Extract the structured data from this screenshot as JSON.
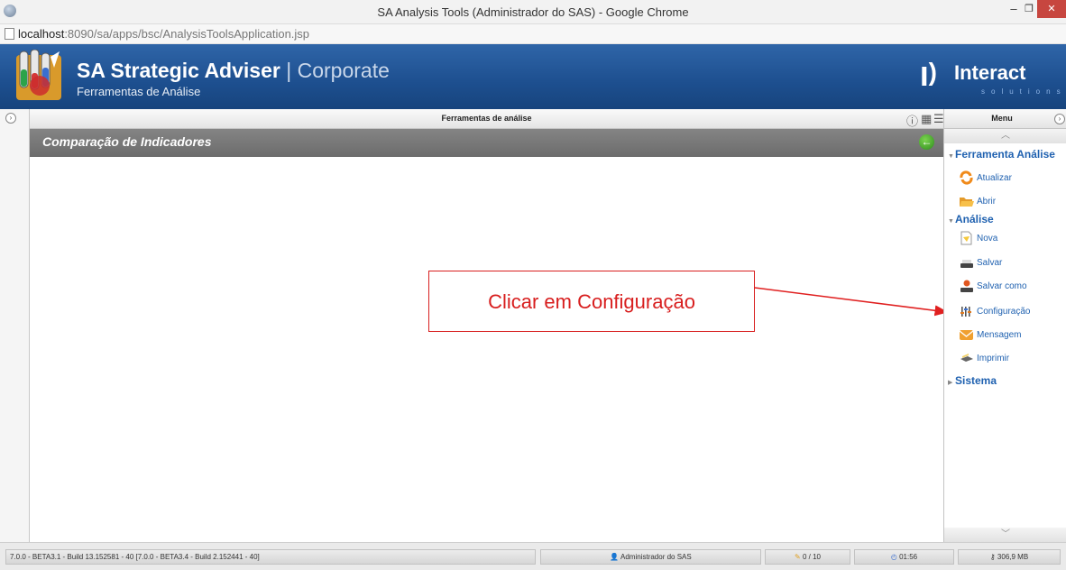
{
  "browser": {
    "window_title": "SA Analysis Tools (Administrador do SAS) - Google Chrome",
    "url_host": "localhost",
    "url_rest": ":8090/sa/apps/bsc/AnalysisToolsApplication.jsp",
    "minimize_glyph": "–",
    "maximize_glyph": "❐",
    "close_glyph": "✕"
  },
  "header": {
    "app_name_bold": "SA Strategic Adviser",
    "app_name_sep": " | ",
    "app_name_light": "Corporate",
    "subtitle": "Ferramentas de Análise",
    "brand_icon": "ꞁ)",
    "brand_name": "Interact",
    "brand_sub": "solutions"
  },
  "tabstrip": {
    "title": "Ferramentas de análise",
    "left_toggle": "›",
    "info_glyph": "ⓘ",
    "grid_glyph": "▦",
    "list_glyph": "☰"
  },
  "panel": {
    "title": "Comparação de Indicadores",
    "back_glyph": "←"
  },
  "annotation": {
    "text": "Clicar em Configuração"
  },
  "menu": {
    "title": "Menu",
    "toggle": "›",
    "scroll_up": "︿",
    "scroll_down": "﹀",
    "sections": [
      {
        "label": "Ferramenta Análise",
        "expanded": true
      },
      {
        "label": "Análise",
        "expanded": true
      },
      {
        "label": "Sistema",
        "expanded": false
      }
    ],
    "items": [
      {
        "label": "Atualizar",
        "icon": "refresh-icon"
      },
      {
        "label": "Abrir",
        "icon": "open-folder-icon"
      },
      {
        "label": "Nova",
        "icon": "new-document-icon"
      },
      {
        "label": "Salvar",
        "icon": "save-icon"
      },
      {
        "label": "Salvar como",
        "icon": "save-as-icon"
      },
      {
        "label": "Configuração",
        "icon": "settings-sliders-icon"
      },
      {
        "label": "Mensagem",
        "icon": "message-icon"
      },
      {
        "label": "Imprimir",
        "icon": "print-icon"
      }
    ]
  },
  "status": {
    "version": "7.0.0 - BETA3.1 - Build 13.152581 - 40 [7.0.0 - BETA3.4 - Build 2.152441 - 40]",
    "user": "Administrador do SAS",
    "counter": "0 / 10",
    "time": "01:56",
    "memory": "306,9 MB"
  }
}
